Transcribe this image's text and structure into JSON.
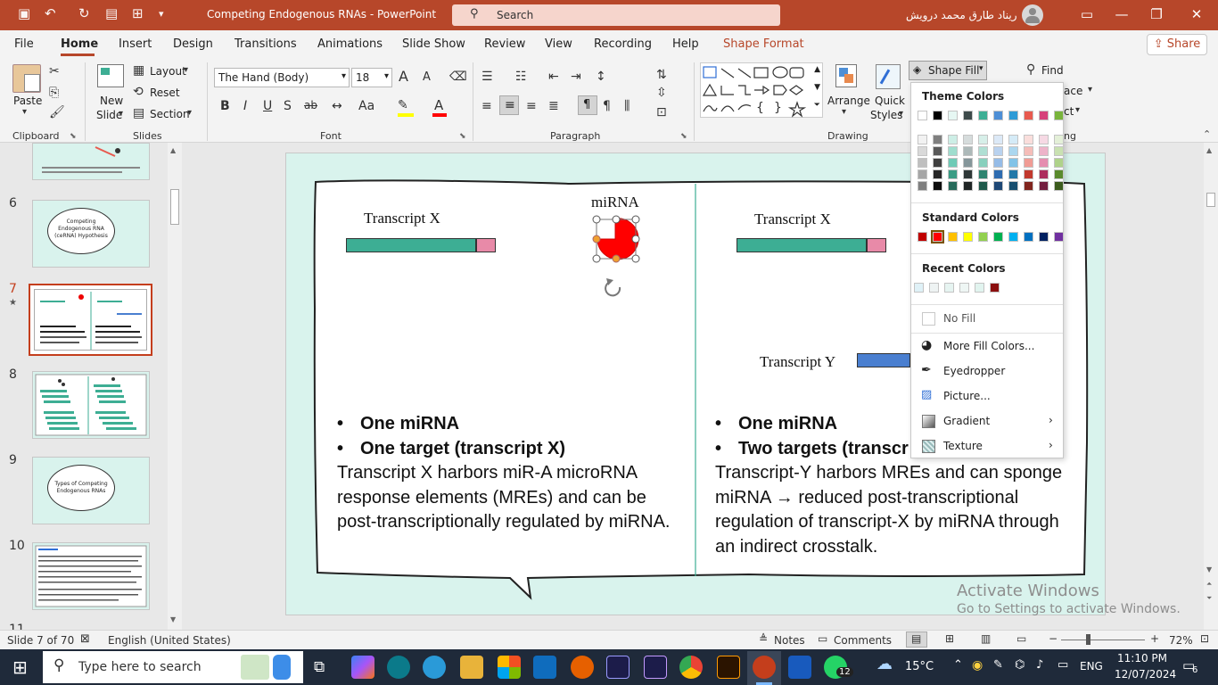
{
  "window": {
    "title": "Competing Endogenous RNAs  -  PowerPoint",
    "search_placeholder": "Search",
    "user_name": "ريناد طارق محمد درويش",
    "accent": "#b7472a"
  },
  "menu": {
    "tabs": [
      "File",
      "Home",
      "Insert",
      "Design",
      "Transitions",
      "Animations",
      "Slide Show",
      "Review",
      "View",
      "Recording",
      "Help",
      "Shape Format"
    ],
    "active": "Home",
    "share_label": "Share"
  },
  "ribbon": {
    "clipboard": {
      "paste": "Paste",
      "group": "Clipboard"
    },
    "slides": {
      "new_slide_1": "New",
      "new_slide_2": "Slide",
      "layout": "Layout",
      "reset": "Reset",
      "section": "Section",
      "group": "Slides"
    },
    "font": {
      "name": "The Hand (Body)",
      "size": "18",
      "group": "Font",
      "bold": "B",
      "italic": "I",
      "underline": "U",
      "shadow": "S",
      "strike": "ab",
      "case": "Aa",
      "grow": "A",
      "shrink": "A"
    },
    "paragraph": {
      "group": "Paragraph"
    },
    "drawing": {
      "arrange": "Arrange",
      "quick_styles_1": "Quick",
      "quick_styles_2": "Styles",
      "group": "Drawing",
      "shape_fill": "Shape Fill"
    },
    "editing": {
      "find": "Find",
      "replace_fragment": "ace",
      "select_fragment": "ct",
      "group_fragment": "ng"
    }
  },
  "thumbnails": [
    {
      "num": "6",
      "text": "Competing Endogenous RNA (ceRNA) Hypothesis"
    },
    {
      "num": "7",
      "text": ""
    },
    {
      "num": "8",
      "text": ""
    },
    {
      "num": "9",
      "text": "Types of Competing Endogenous RNAs"
    },
    {
      "num": "10",
      "text": ""
    },
    {
      "num": "11",
      "text": ""
    }
  ],
  "slide": {
    "left_transcript": "Transcript X",
    "mirna_label": "miRNA",
    "right_transcript": "Transcript X",
    "transcript_y": "Transcript Y",
    "left_bullets": [
      "One miRNA",
      "One target (transcript X)"
    ],
    "left_para": "Transcript X harbors miR-A microRNA response elements (MREs) and can be post-transcriptionally regulated by miRNA.",
    "right_bullets": [
      "One miRNA",
      "Two targets (transcr"
    ],
    "right_para": "Transcript-Y harbors MREs and can sponge miRNA → reduced post-transcriptional regulation of transcript-X by miRNA through an indirect crosstalk.",
    "colors": {
      "bar": "#3dae94",
      "bar_tip": "#e88aa8",
      "mirna": "#ff0000",
      "bar_y": "#4a7fd0",
      "bg": "#d9f3ed"
    }
  },
  "fill_menu": {
    "theme_label": "Theme Colors",
    "standard_label": "Standard Colors",
    "recent_label": "Recent Colors",
    "no_fill": "No Fill",
    "more_colors": "More Fill Colors...",
    "eyedropper": "Eyedropper",
    "picture": "Picture...",
    "gradient": "Gradient",
    "texture": "Texture",
    "theme_top": [
      "#ffffff",
      "#000000",
      "#e6f7f3",
      "#3d4a4a",
      "#3dae94",
      "#4e8fd6",
      "#2f9bd6",
      "#e85a4f",
      "#d6417a",
      "#79b43c"
    ],
    "theme_cols": [
      [
        "#f2f2f2",
        "#d9d9d9",
        "#bfbfbf",
        "#a6a6a6",
        "#7f7f7f"
      ],
      [
        "#7f7f7f",
        "#595959",
        "#3f3f3f",
        "#262626",
        "#0d0d0d"
      ],
      [
        "#cdeee6",
        "#9fddce",
        "#6fcbb6",
        "#3a9c84",
        "#276b5b"
      ],
      [
        "#d6dcdc",
        "#adb9b9",
        "#85969a",
        "#2e3737",
        "#1f2525"
      ],
      [
        "#d7efe9",
        "#afdfd3",
        "#88d0bd",
        "#2e8470",
        "#1f5a4b"
      ],
      [
        "#dce9f7",
        "#b9d2ef",
        "#96bce7",
        "#2e6cb0",
        "#1e4876"
      ],
      [
        "#d5ebf7",
        "#abd7ef",
        "#82c3e7",
        "#2278a8",
        "#174f70"
      ],
      [
        "#fadedc",
        "#f5bdb9",
        "#f09c95",
        "#c1382d",
        "#81251e"
      ],
      [
        "#f6d9e4",
        "#edb3c9",
        "#e58daf",
        "#ad2d5d",
        "#731e3e"
      ],
      [
        "#e4f0d8",
        "#c9e1b1",
        "#afd28a",
        "#5a8a2c",
        "#3c5c1d"
      ]
    ],
    "standard": [
      "#c00000",
      "#ff0000",
      "#ffc000",
      "#ffff00",
      "#92d050",
      "#00b050",
      "#00b0f0",
      "#0070c0",
      "#002060",
      "#7030a0"
    ],
    "recent": [
      "#dff1f7",
      "#eef3f3",
      "#e6f4f1",
      "#eef6f4",
      "#e1f4ef",
      "#8b0f0f"
    ]
  },
  "status": {
    "slide_pos": "Slide 7 of 70",
    "language": "English (United States)",
    "notes": "Notes",
    "comments": "Comments",
    "zoom": "72%"
  },
  "watermark": {
    "line1": "Activate Windows",
    "line2": "Go to Settings to activate Windows."
  },
  "taskbar": {
    "search_placeholder": "Type here to search",
    "weather": "15°C",
    "lang": "ENG",
    "time": "11:10 PM",
    "date": "12/07/2024",
    "whatsapp_badge": "12",
    "notif_count": "6"
  }
}
